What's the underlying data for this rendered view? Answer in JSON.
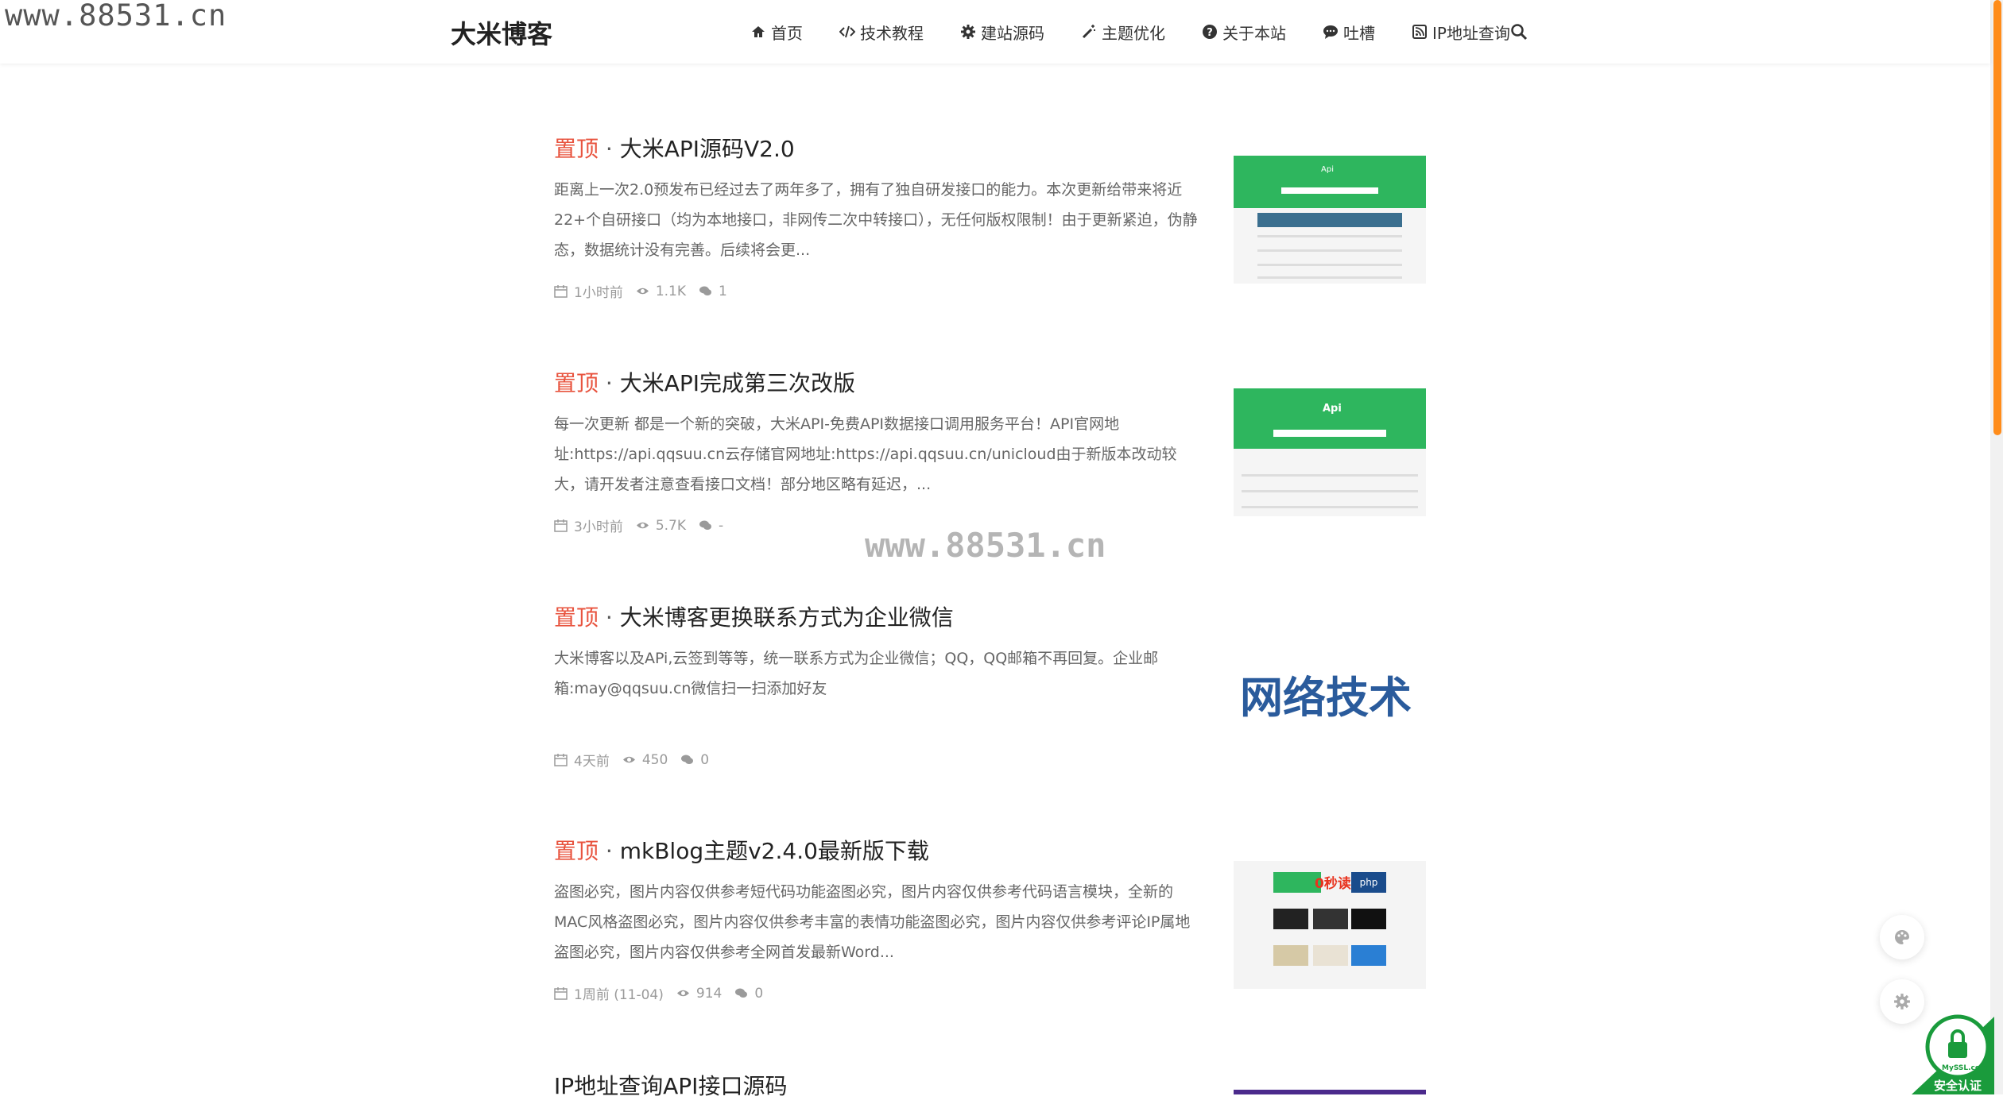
{
  "watermarks": {
    "top_left": "www.88531.cn",
    "center": "www.88531.cn"
  },
  "site": {
    "brand": "大米博客"
  },
  "nav": {
    "items": [
      {
        "label": "首页",
        "icon": "home-icon"
      },
      {
        "label": "技术教程",
        "icon": "code-icon"
      },
      {
        "label": "建站源码",
        "icon": "gear-icon"
      },
      {
        "label": "主题优化",
        "icon": "magic-wand-icon"
      },
      {
        "label": "关于本站",
        "icon": "question-circle-icon"
      },
      {
        "label": "吐槽",
        "icon": "comment-icon"
      },
      {
        "label": "IP地址查询",
        "icon": "rss-square-icon"
      }
    ],
    "search_icon": "search-icon"
  },
  "posts": [
    {
      "sticky": "置顶",
      "sep": " · ",
      "title": "大米API源码V2.0",
      "excerpt": "距离上一次2.0预发布已经过去了两年多了，拥有了独自研发接口的能力。本次更新给带来将近22+个自研接口（均为本地接口，非网传二次中转接口），无任何版权限制！由于更新紧迫，伪静态，数据统计没有完善。后续将会更...",
      "time": "1小时前",
      "views": "1.1K",
      "comments": "1"
    },
    {
      "sticky": "置顶",
      "sep": " · ",
      "title": "大米API完成第三次改版",
      "excerpt": " 每一次更新 都是一个新的突破，大米API-免费API数据接口调用服务平台！API官网地址:https://api.qqsuu.cn云存储官网地址:https://api.qqsuu.cn/unicloud由于新版本改动较大，请开发者注意查看接口文档！部分地区略有延迟，...",
      "time": "3小时前",
      "views": "5.7K",
      "comments": "-"
    },
    {
      "sticky": "置顶",
      "sep": " · ",
      "title": "大米博客更换联系方式为企业微信",
      "excerpt": "大米博客以及APi,云签到等等，统一联系方式为企业微信；QQ，QQ邮箱不再回复。企业邮箱:may@qqsuu.cn微信扫一扫添加好友",
      "time": "4天前",
      "views": "450",
      "comments": "0",
      "thumb_text": "网络技术"
    },
    {
      "sticky": "置顶",
      "sep": " · ",
      "title": "mkBlog主题v2.4.0最新版下载",
      "excerpt": "盗图必究，图片内容仅供参考短代码功能盗图必究，图片内容仅供参考代码语言模块，全新的MAC风格盗图必究，图片内容仅供参考丰富的表情功能盗图必究，图片内容仅供参考评论IP属地盗图必究，图片内容仅供参考全网首发最新Word...",
      "time": "1周前 (11-04)",
      "views": "914",
      "comments": "0"
    },
    {
      "title": "IP地址查询API接口源码"
    }
  ],
  "thumbs": {
    "api_label": "Api",
    "mk_seconds": "0秒读",
    "mk_php": "php"
  },
  "float_buttons": [
    {
      "icon": "palette-icon"
    },
    {
      "icon": "settings-icon"
    }
  ],
  "ssl_badge": {
    "label": "安全认证",
    "ring_text": "MySSL.com"
  },
  "colors": {
    "sticky": "#e8533e",
    "scroll_thumb": "#ff8c1a",
    "thumb_green": "#2eb65e"
  }
}
